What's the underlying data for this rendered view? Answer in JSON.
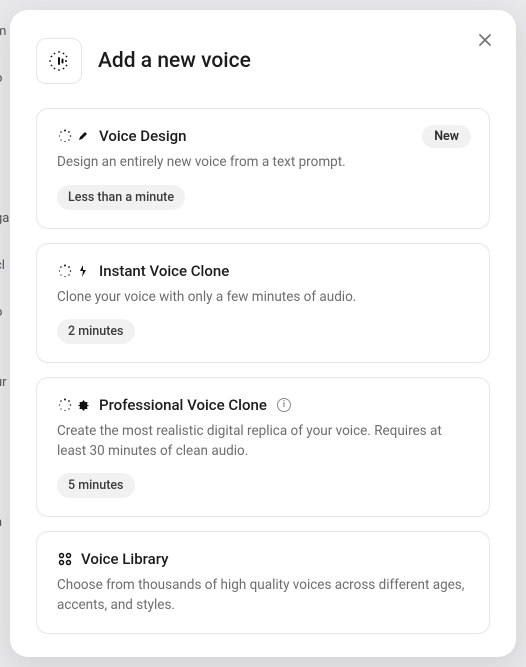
{
  "modal": {
    "title": "Add a new voice",
    "close_label": "Close"
  },
  "options": [
    {
      "key": "voice-design",
      "title": "Voice Design",
      "description": "Design an entirely new voice from a text prompt.",
      "duration": "Less than a minute",
      "badge": "New",
      "info": false
    },
    {
      "key": "instant-voice-clone",
      "title": "Instant Voice Clone",
      "description": "Clone your voice with only a few minutes of audio.",
      "duration": "2 minutes",
      "badge": null,
      "info": false
    },
    {
      "key": "professional-voice-clone",
      "title": "Professional Voice Clone",
      "description": "Create the most realistic digital replica of your voice. Requires at least 30 minutes of clean audio.",
      "duration": "5 minutes",
      "badge": null,
      "info": true
    },
    {
      "key": "voice-library",
      "title": "Voice Library",
      "description": "Choose from thousands of high quality voices across different ages, accents, and styles.",
      "duration": null,
      "badge": null,
      "info": false
    }
  ],
  "icons": {
    "header": "voice-wave-icon",
    "option_accent": [
      "pencil-icon",
      "bolt-icon",
      "badge-icon",
      "grid-icon"
    ]
  }
}
